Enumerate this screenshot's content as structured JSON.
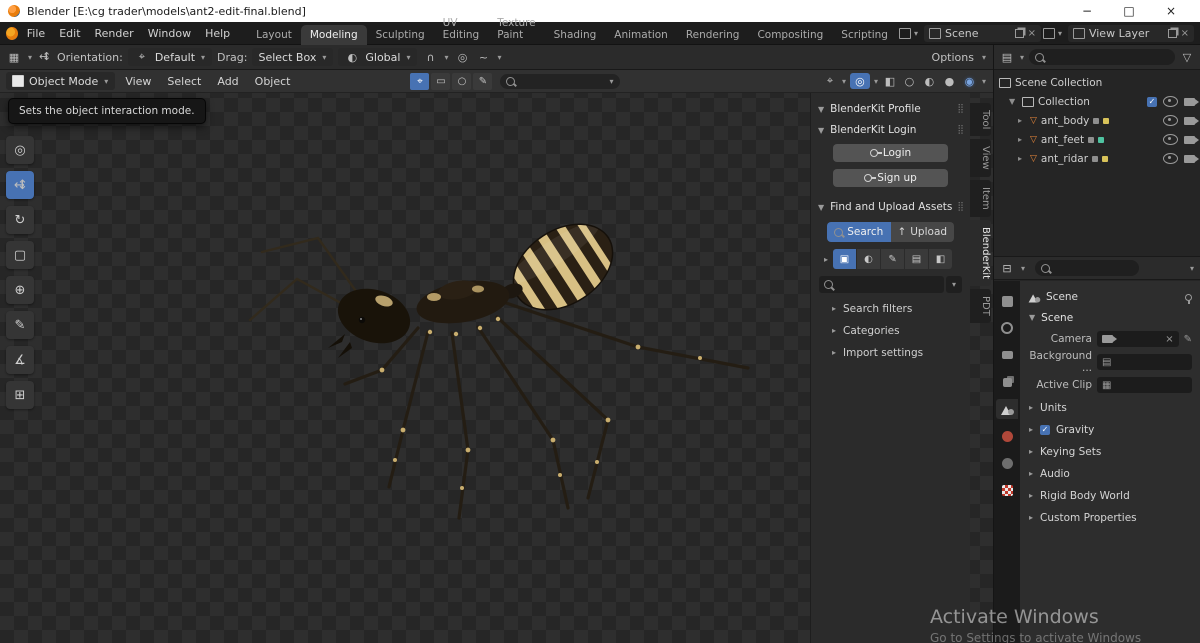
{
  "colors": {
    "accent_blue": "#4772b3",
    "blender_orange": "#e87d0d",
    "titlebar_bg": "#ffffff",
    "menubar_bg": "#1d1d1d",
    "panel_bg": "#2b2b2b",
    "button_gray": "#545454",
    "checker_light": "#2e2e2e",
    "checker_dark": "#262626"
  },
  "icons": {
    "chev": "▾",
    "open": "▼",
    "closed": "▸",
    "dots": "⣿",
    "cursor_tool": "◎",
    "rotate_tool": "↻",
    "scale_tool": "▢",
    "transform_tool": "⊕",
    "annotate_tool": "✎",
    "measure_tool": "∡",
    "add_cube_tool": "⊞",
    "mesh": "▽",
    "up_arrow": "↑",
    "close": "×",
    "tweak": "⌖",
    "box_select": "▭",
    "circle_select": "○",
    "lasso_select": "✎",
    "wire": "○",
    "solid": "◐",
    "material": "●",
    "rendered": "◉",
    "asset_model": "▣",
    "asset_material": "◐",
    "asset_brush": "✎",
    "asset_scene": "▤",
    "asset_hdr": "◧",
    "magnet": "∩",
    "falloff": "~",
    "funnel": "▽",
    "grid": "▦",
    "layers": "▤",
    "props": "⊟",
    "check": "✓"
  },
  "titlebar": {
    "title": "Blender [E:\\cg trader\\models\\ant2-edit-final.blend]",
    "minimize": "−",
    "maximize": "□",
    "close": "×"
  },
  "topbar": {
    "menus": [
      "File",
      "Edit",
      "Render",
      "Window",
      "Help"
    ],
    "workspaces": [
      "Layout",
      "Modeling",
      "Sculpting",
      "UV Editing",
      "Texture Paint",
      "Shading",
      "Animation",
      "Rendering",
      "Compositing",
      "Scripting"
    ],
    "scene": "Scene",
    "view_layer": "View Layer"
  },
  "tools": {
    "orientation_label": "Orientation:",
    "orientation_value": "Default",
    "drag_label": "Drag:",
    "drag_value": "Select Box",
    "transform_space": "Global",
    "options": "Options"
  },
  "viewport": {
    "mode": "Object Mode",
    "menus": [
      "View",
      "Select",
      "Add",
      "Object"
    ],
    "tooltip": "Sets the object interaction mode."
  },
  "panel_tabs": [
    "Tool",
    "View",
    "Item",
    "BlenderKit",
    "PDT"
  ],
  "bk": {
    "profile": "BlenderKit Profile",
    "login_section": "BlenderKit Login",
    "login": "Login",
    "signup": "Sign up",
    "assets": "Find and Upload Assets",
    "search": "Search",
    "upload": "Upload",
    "rows": [
      "Search filters",
      "Categories",
      "Import settings"
    ]
  },
  "ol": {
    "scene_collection": "Scene Collection",
    "collection": "Collection",
    "objects": [
      "ant_body",
      "ant_feet",
      "ant_ridar"
    ]
  },
  "pr": {
    "breadcrumb": "Scene",
    "section": "Scene",
    "camera": "Camera",
    "background": "Background ...",
    "active_clip": "Active Clip",
    "items": [
      "Units",
      "Gravity",
      "Keying Sets",
      "Audio",
      "Rigid Body World",
      "Custom Properties"
    ]
  },
  "wm": {
    "title": "Activate Windows",
    "subtitle": "Go to Settings to activate Windows"
  }
}
